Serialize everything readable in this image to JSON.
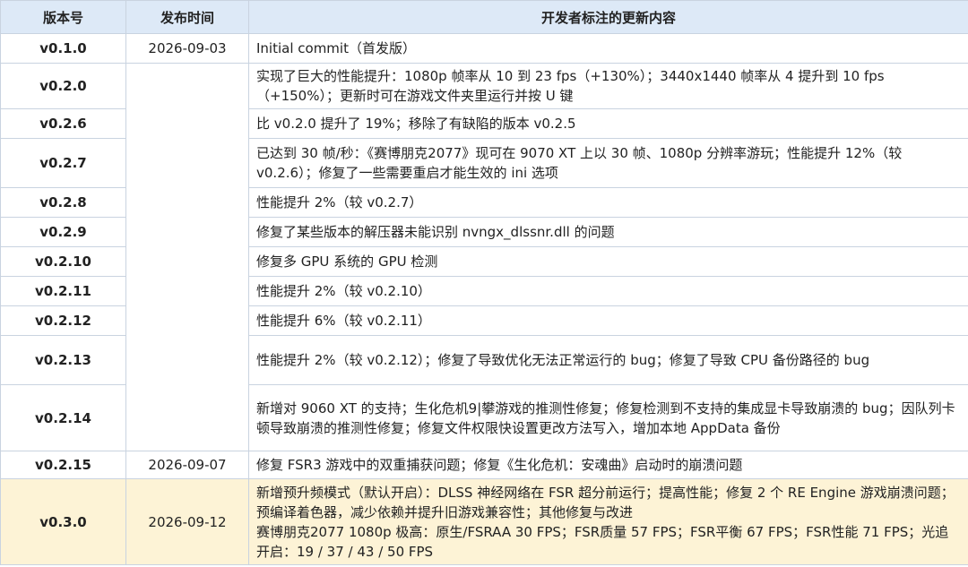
{
  "headers": {
    "version": "版本号",
    "date": "发布时间",
    "notes": "开发者标注的更新内容"
  },
  "rows": [
    {
      "version": "v0.1.0",
      "date": "2026-09-03",
      "notes": "Initial commit（首发版）"
    },
    {
      "version": "v0.2.0",
      "notes": "实现了巨大的性能提升：1080p 帧率从 10 到 23 fps（+130%）；3440x1440 帧率从 4 提升到 10 fps（+150%）；更新时可在游戏文件夹里运行并按 U 键"
    },
    {
      "version": "v0.2.6",
      "notes": "比 v0.2.0 提升了 19%；移除了有缺陷的版本 v0.2.5"
    },
    {
      "version": "v0.2.7",
      "notes": "已达到 30 帧/秒：《赛博朋克2077》现可在 9070 XT 上以 30 帧、1080p 分辨率游玩；性能提升 12%（较 v0.2.6）；修复了一些需要重启才能生效的 ini 选项"
    },
    {
      "version": "v0.2.8",
      "notes": "性能提升 2%（较 v0.2.7）"
    },
    {
      "version": "v0.2.9",
      "notes": "修复了某些版本的解压器未能识别 nvngx_dlssnr.dll 的问题"
    },
    {
      "version": "v0.2.10",
      "notes": "修复多 GPU 系统的 GPU 检测"
    },
    {
      "version": "v0.2.11",
      "notes": "性能提升 2%（较 v0.2.10）"
    },
    {
      "version": "v0.2.12",
      "notes": "性能提升 6%（较 v0.2.11）"
    },
    {
      "version": "v0.2.13",
      "notes": "性能提升 2%（较 v0.2.12）；修复了导致优化无法正常运行的 bug；修复了导致 CPU 备份路径的 bug"
    },
    {
      "version": "v0.2.14",
      "notes": "新增对 9060 XT 的支持；生化危机9|攀游戏的推测性修复；修复检测到不支持的集成显卡导致崩溃的 bug；因队列卡顿导致崩溃的推测性修复；修复文件权限快设置更改方法写入，增加本地 AppData 备份"
    },
    {
      "version": "v0.2.15",
      "date": "2026-09-07",
      "notes": "修复 FSR3 游戏中的双重捕获问题；修复《生化危机：安魂曲》启动时的崩溃问题"
    },
    {
      "version": "v0.3.0",
      "date": "2026-09-12",
      "notes": "新增预升频模式（默认开启）：DLSS 神经网络在 FSR 超分前运行；提高性能；修复 2 个 RE Engine 游戏崩溃问题；预编译着色器，减少依赖并提升旧游戏兼容性；其他修复与改进",
      "notes2": "赛博朋克2077 1080p 极高：原生/FSRAA 30 FPS；FSR质量 57 FPS；FSR平衡 67 FPS；FSR性能 71 FPS；光追开启：19 / 37 / 43 / 50 FPS"
    }
  ]
}
